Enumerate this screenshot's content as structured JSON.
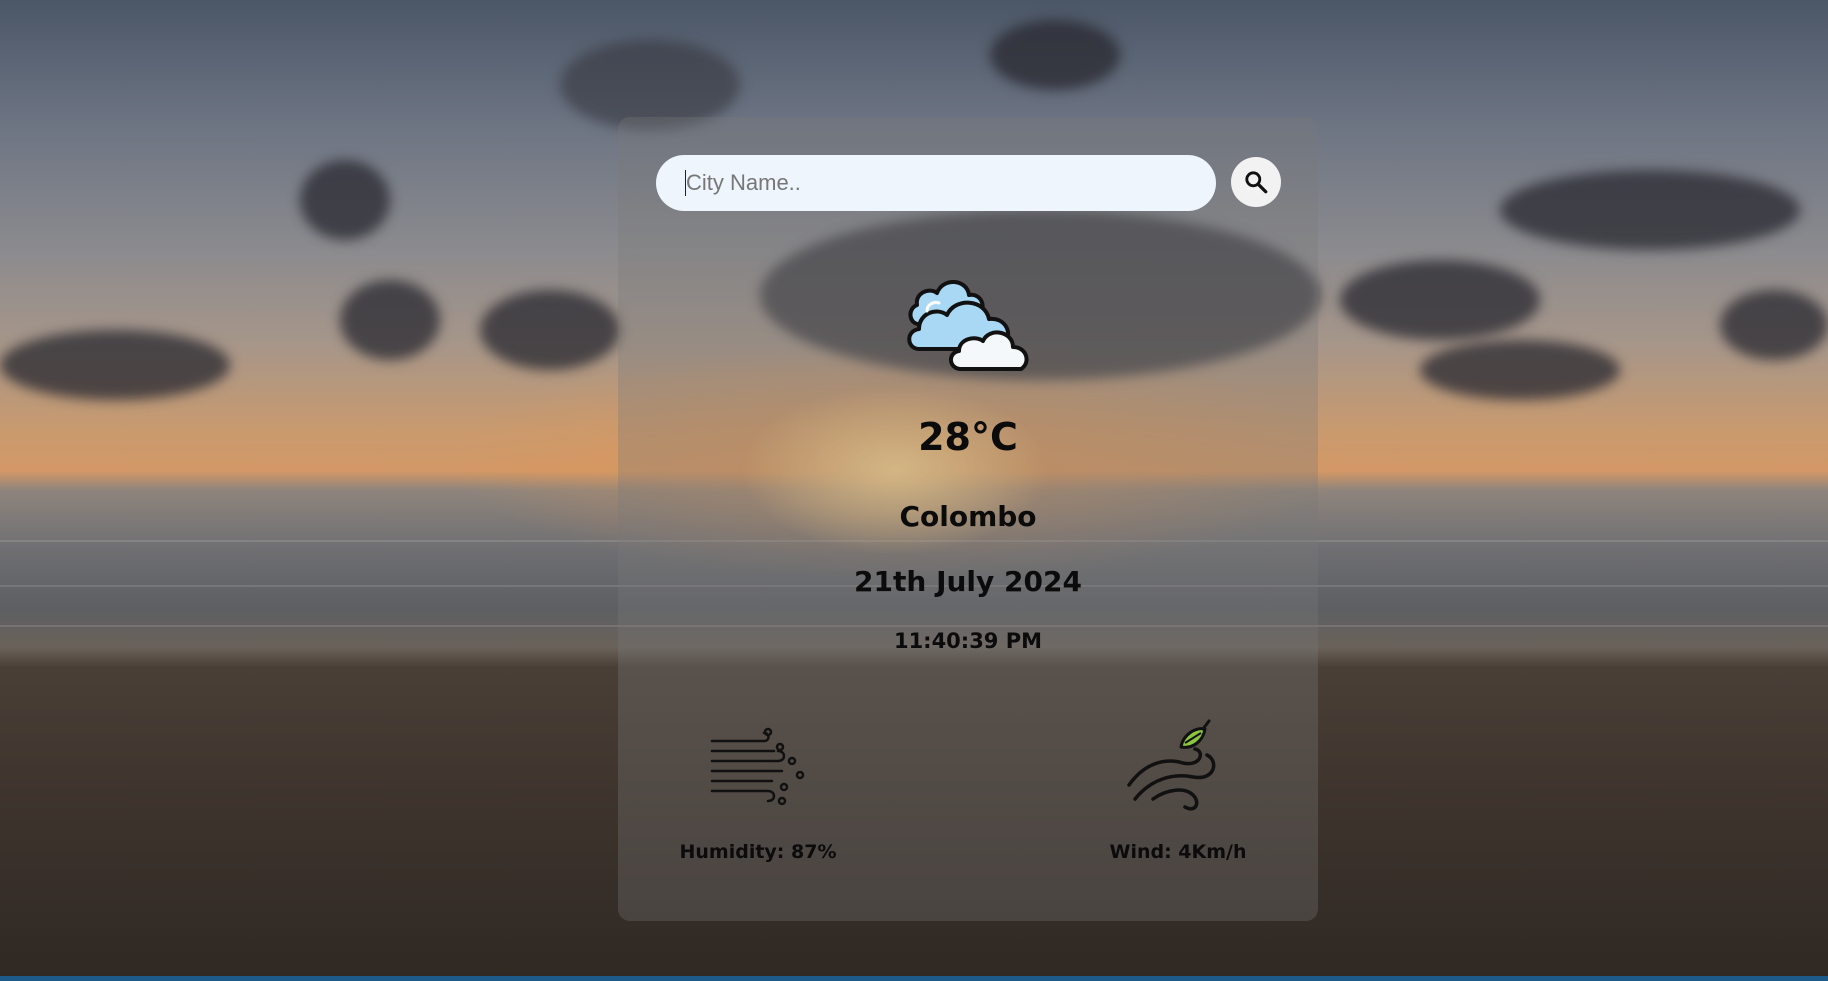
{
  "search": {
    "placeholder": "City Name..",
    "value": "",
    "button_icon": "search-icon"
  },
  "weather": {
    "icon": "cloudy-icon",
    "temperature": "28°C",
    "city": "Colombo",
    "date": "21th July 2024",
    "time": "11:40:39 PM"
  },
  "details": {
    "humidity_icon": "humidity-icon",
    "humidity_label": "Humidity: 87%",
    "wind_icon": "wind-icon",
    "wind_label": "Wind: 4Km/h"
  },
  "colors": {
    "card_overlay": "#787878",
    "input_bg": "#eef5fc",
    "cloud_fill": "#a8d8f4",
    "leaf_fill": "#8cc63f",
    "text": "#0b0b0b"
  }
}
